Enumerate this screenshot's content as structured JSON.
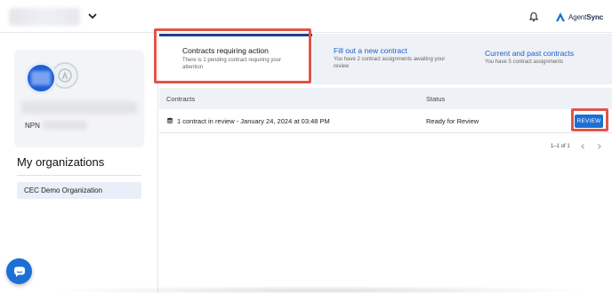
{
  "header": {
    "brand_text_light": "Agent",
    "brand_text_bold": "Sync",
    "icons": {
      "org_dropdown": "chevron-down-icon",
      "notifications": "bell-icon",
      "brand": "agentsync-logo-icon"
    }
  },
  "sidebar": {
    "npn_label": "NPN",
    "organizations_title": "My organizations",
    "organizations": [
      {
        "label": "CEC Demo Organization"
      }
    ],
    "chat_icon": "chat-bubble-icon"
  },
  "tabs": [
    {
      "title": "Contracts requiring action",
      "description": "There is 1 pending contract requiring your attention",
      "active": true
    },
    {
      "title": "Fill out a new contract",
      "description": "You have 2 contract assignments awaiting your review",
      "active": false
    },
    {
      "title": "Current and past contracts",
      "description": "You have 5 contract assignments",
      "active": false
    }
  ],
  "table": {
    "columns": [
      "Contracts",
      "Status"
    ],
    "rows": [
      {
        "contract": "1 contract in review - January 24, 2024 at 03:48 PM",
        "status": "Ready for Review",
        "action_label": "REVIEW",
        "icon": "stack-icon"
      }
    ]
  },
  "pagination": {
    "range_label": "1–1 of 1",
    "prev_icon": "chevron-left-icon",
    "next_icon": "chevron-right-icon"
  },
  "colors": {
    "accent": "#1c6fd7",
    "highlight": "#e0544b",
    "active_tab_border": "#1f3f8a"
  }
}
